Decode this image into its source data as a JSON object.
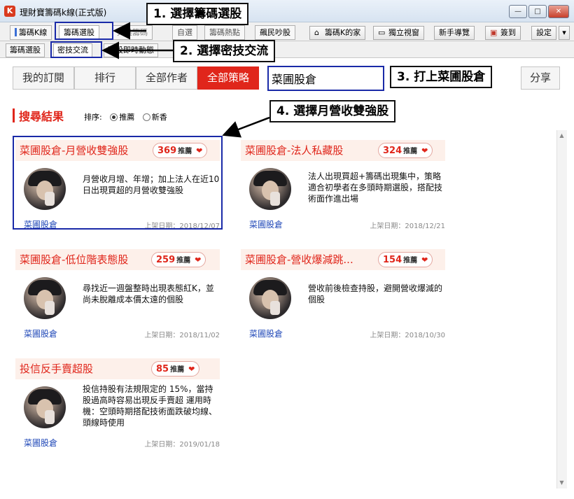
{
  "window": {
    "title": "理財寶籌碼k線(正式版)",
    "icon_label": "K",
    "buttons": {
      "minimize": "—",
      "maximize": "□",
      "close": "✕"
    }
  },
  "main_tabs": [
    {
      "label": "籌碼K線",
      "active": false
    },
    {
      "label": "籌碼選股",
      "active": true
    },
    {
      "label": "大盤籌碼",
      "active": false
    }
  ],
  "main_tab_partial": [
    "自選",
    "籌碼熱點",
    "飆民吵股"
  ],
  "toolbar_buttons": [
    {
      "label": "籌碼K的家",
      "icon": "home-icon",
      "glyph": "⌂"
    },
    {
      "label": "獨立視窗",
      "icon": "window-icon",
      "glyph": "▭"
    },
    {
      "label": "新手導覽",
      "icon": "",
      "glyph": ""
    },
    {
      "label": "簽到",
      "icon": "gift-icon",
      "glyph": "▣"
    },
    {
      "label": "設定",
      "icon": "",
      "glyph": ""
    }
  ],
  "dropdown_glyph": "▾",
  "sub_tabs": [
    {
      "label": "籌碼選股",
      "active": false
    },
    {
      "label": "密技交流",
      "active": true
    },
    {
      "label": "選股即時動態",
      "active": false
    }
  ],
  "filters": [
    {
      "label": "我的訂閱",
      "active": false
    },
    {
      "label": "排行",
      "active": false
    },
    {
      "label": "全部作者",
      "active": false
    },
    {
      "label": "全部策略",
      "active": true
    }
  ],
  "search": {
    "value": "菜圃股倉"
  },
  "share_label": "分享",
  "results": {
    "title": "搜尋結果",
    "sort_label": "排序:",
    "sort_options": [
      {
        "label": "推薦",
        "selected": true
      },
      {
        "label": "新香",
        "selected": false
      }
    ]
  },
  "recommend_label": "推薦",
  "heart_glyph": "❤",
  "cards": [
    {
      "title": "菜圃股倉-月營收雙強股",
      "count": "369",
      "description": "月營收月增、年增；加上法人在近10日出現買超的月營收雙強股",
      "author": "菜圃股倉",
      "date": "上架日期：2018/12/07"
    },
    {
      "title": "菜圃股倉-法人私藏股",
      "count": "324",
      "description": "法人出現買超+籌碼出現集中，策略適合初學者在多頭時期選股，搭配技術面作進出場",
      "author": "菜圃股倉",
      "date": "上架日期：2018/12/21"
    },
    {
      "title": "菜圃股倉-低位階表態股",
      "count": "259",
      "description": "尋找近一週盤整時出現表態紅K，並尚未脫離成本價太遠的個股",
      "author": "菜圃股倉",
      "date": "上架日期：2018/11/02"
    },
    {
      "title": "菜圃股倉-營收爆減跳...",
      "count": "154",
      "description": "營收前後檢查持股，避開營收爆減的個股",
      "author": "菜圃股倉",
      "date": "上架日期：2018/10/30"
    },
    {
      "title": "投信反手賣超股",
      "count": "85",
      "description": "投信持股有法規限定的 15%，當持股過高時容易出現反手賣超 運用時機：空頭時期搭配技術面跌破均線、頭線時使用",
      "author": "菜圃股倉",
      "date": "上架日期：2019/01/18"
    }
  ],
  "annotations": {
    "step1": "1. 選擇籌碼選股",
    "step2": "2. 選擇密技交流",
    "step3": "3. 打上菜圃股倉",
    "step4": "4. 選擇月營收雙強股"
  }
}
